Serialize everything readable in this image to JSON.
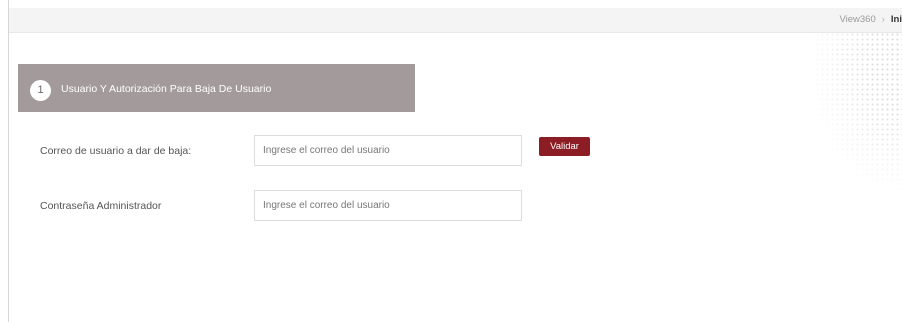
{
  "breadcrumb": {
    "items": [
      "View360",
      "Ini"
    ]
  },
  "section": {
    "step": "1",
    "title": "Usuario Y Autorización Para Baja De Usuario"
  },
  "form": {
    "email_label": "Correo de usuario a dar de baja:",
    "email_placeholder": "Ingrese el correo del usuario",
    "validate_label": "Validar",
    "password_label": "Contraseña Administrador",
    "password_placeholder": "Ingrese el correo del usuario"
  },
  "colors": {
    "header_bg": "#a39b9b",
    "button_bg": "#8c1d24"
  }
}
